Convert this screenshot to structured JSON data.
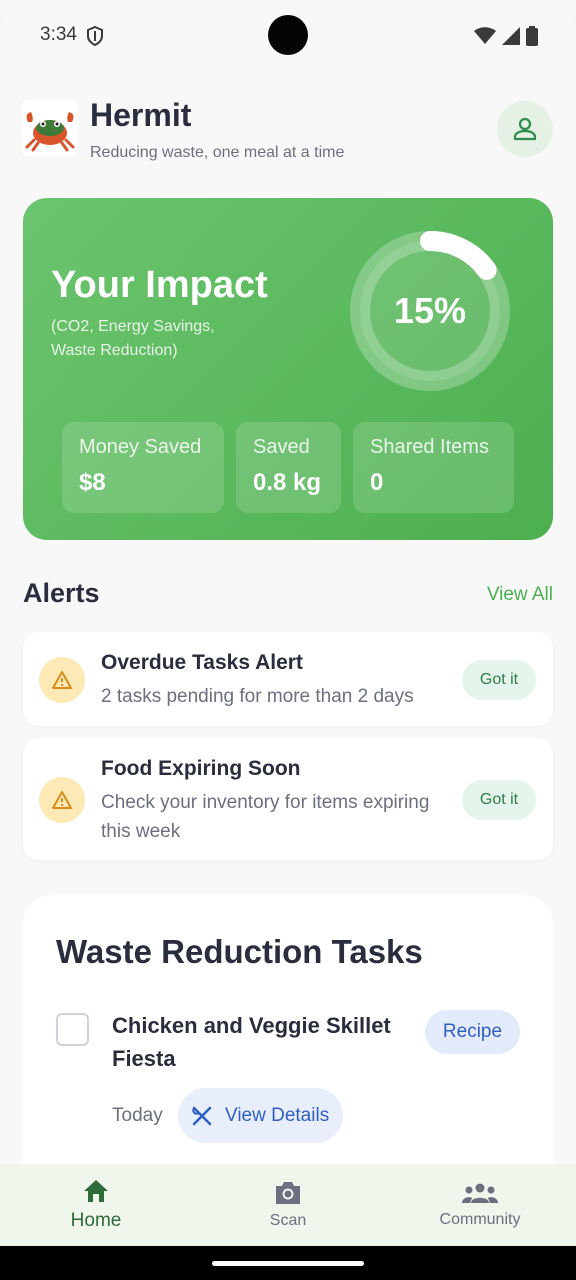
{
  "status_bar": {
    "time": "3:34"
  },
  "header": {
    "app_name": "Hermit",
    "tagline": "Reducing waste, one meal at a time"
  },
  "impact": {
    "title": "Your Impact",
    "subtitle": "(CO2, Energy Savings, Waste Reduction)",
    "progress_percent": 15,
    "progress_label": "15%",
    "stats": [
      {
        "label": "Money Saved",
        "value": "$8"
      },
      {
        "label": "Saved",
        "value": "0.8 kg"
      },
      {
        "label": "Shared Items",
        "value": "0"
      }
    ]
  },
  "alerts": {
    "title": "Alerts",
    "view_all": "View All",
    "items": [
      {
        "title": "Overdue Tasks Alert",
        "body": "2 tasks pending for more than 2 days",
        "action": "Got it"
      },
      {
        "title": "Food Expiring Soon",
        "body": "Check your inventory for items expiring this week",
        "action": "Got it"
      }
    ]
  },
  "tasks": {
    "title": "Waste Reduction Tasks",
    "items": [
      {
        "name": "Chicken and Veggie Skillet Fiesta",
        "tag": "Recipe",
        "date": "Today",
        "details_label": "View Details"
      }
    ]
  },
  "nav": {
    "items": [
      {
        "label": "Home",
        "icon": "home-icon",
        "active": true
      },
      {
        "label": "Scan",
        "icon": "camera-icon",
        "active": false
      },
      {
        "label": "Community",
        "icon": "people-icon",
        "active": false
      }
    ]
  },
  "colors": {
    "accent": "#4caf50",
    "warning_bg": "#fde9b5",
    "warning_icon": "#d98a1a",
    "chip_blue": "#2f5fc4"
  }
}
